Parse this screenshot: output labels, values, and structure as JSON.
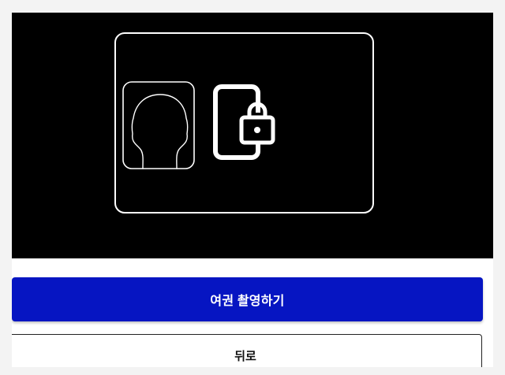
{
  "camera": {
    "guide_icons": [
      "id-card-frame",
      "face-portrait-icon",
      "phone-lock-icon"
    ]
  },
  "actions": {
    "capture_passport_label": "여권 촬영하기",
    "back_label": "뒤로"
  },
  "colors": {
    "primary": "#0615c2",
    "camera_background": "#000000",
    "outline": "#ffffff"
  }
}
